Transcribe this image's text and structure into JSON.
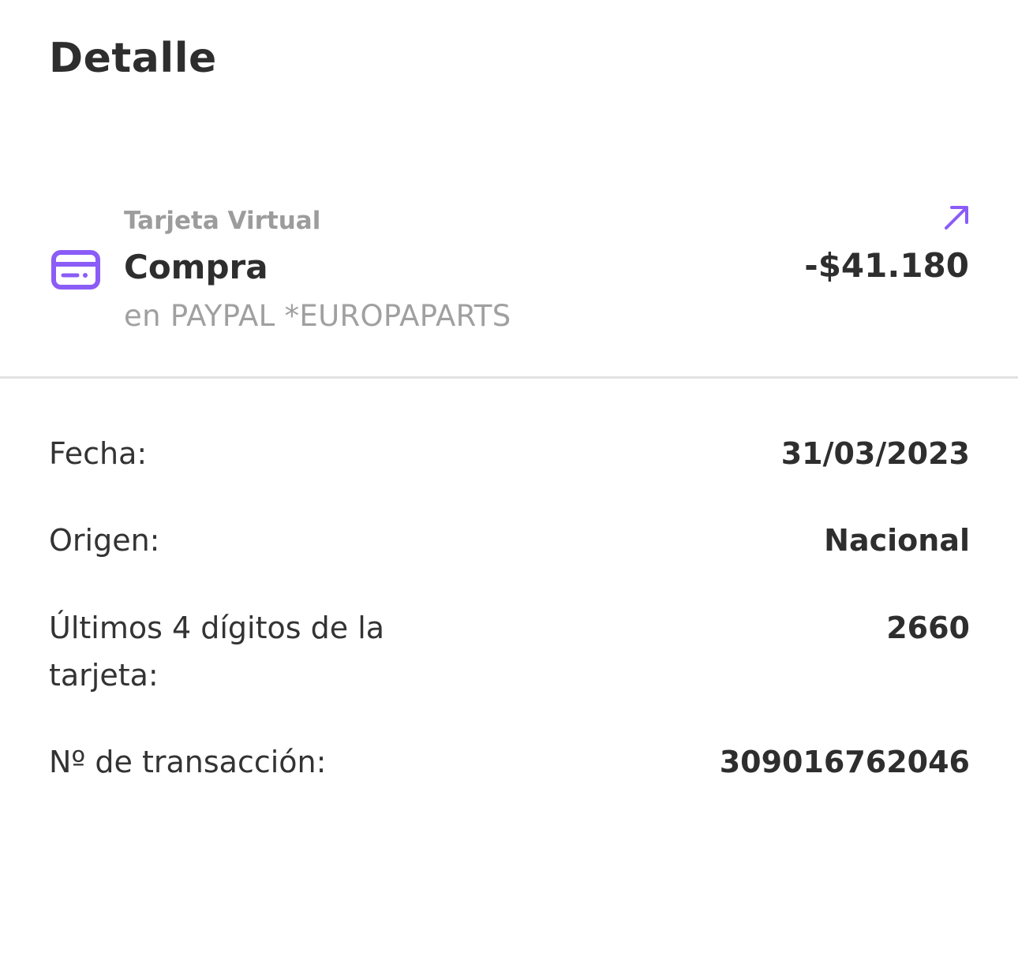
{
  "header": {
    "title": "Detalle"
  },
  "transaction": {
    "channel": "Tarjeta Virtual",
    "type": "Compra",
    "merchant": "en PAYPAL *EUROPAPARTS",
    "amount": "-$41.180",
    "icon": "credit-card-icon",
    "direction_icon": "arrow-up-right-icon",
    "accent_color": "#8b5cf6"
  },
  "details": [
    {
      "label": "Fecha:",
      "value": "31/03/2023"
    },
    {
      "label": "Origen:",
      "value": "Nacional"
    },
    {
      "label": "Últimos 4 dígitos de la tarjeta:",
      "value": "2660"
    },
    {
      "label": "Nº de transacción:",
      "value": "309016762046"
    }
  ]
}
